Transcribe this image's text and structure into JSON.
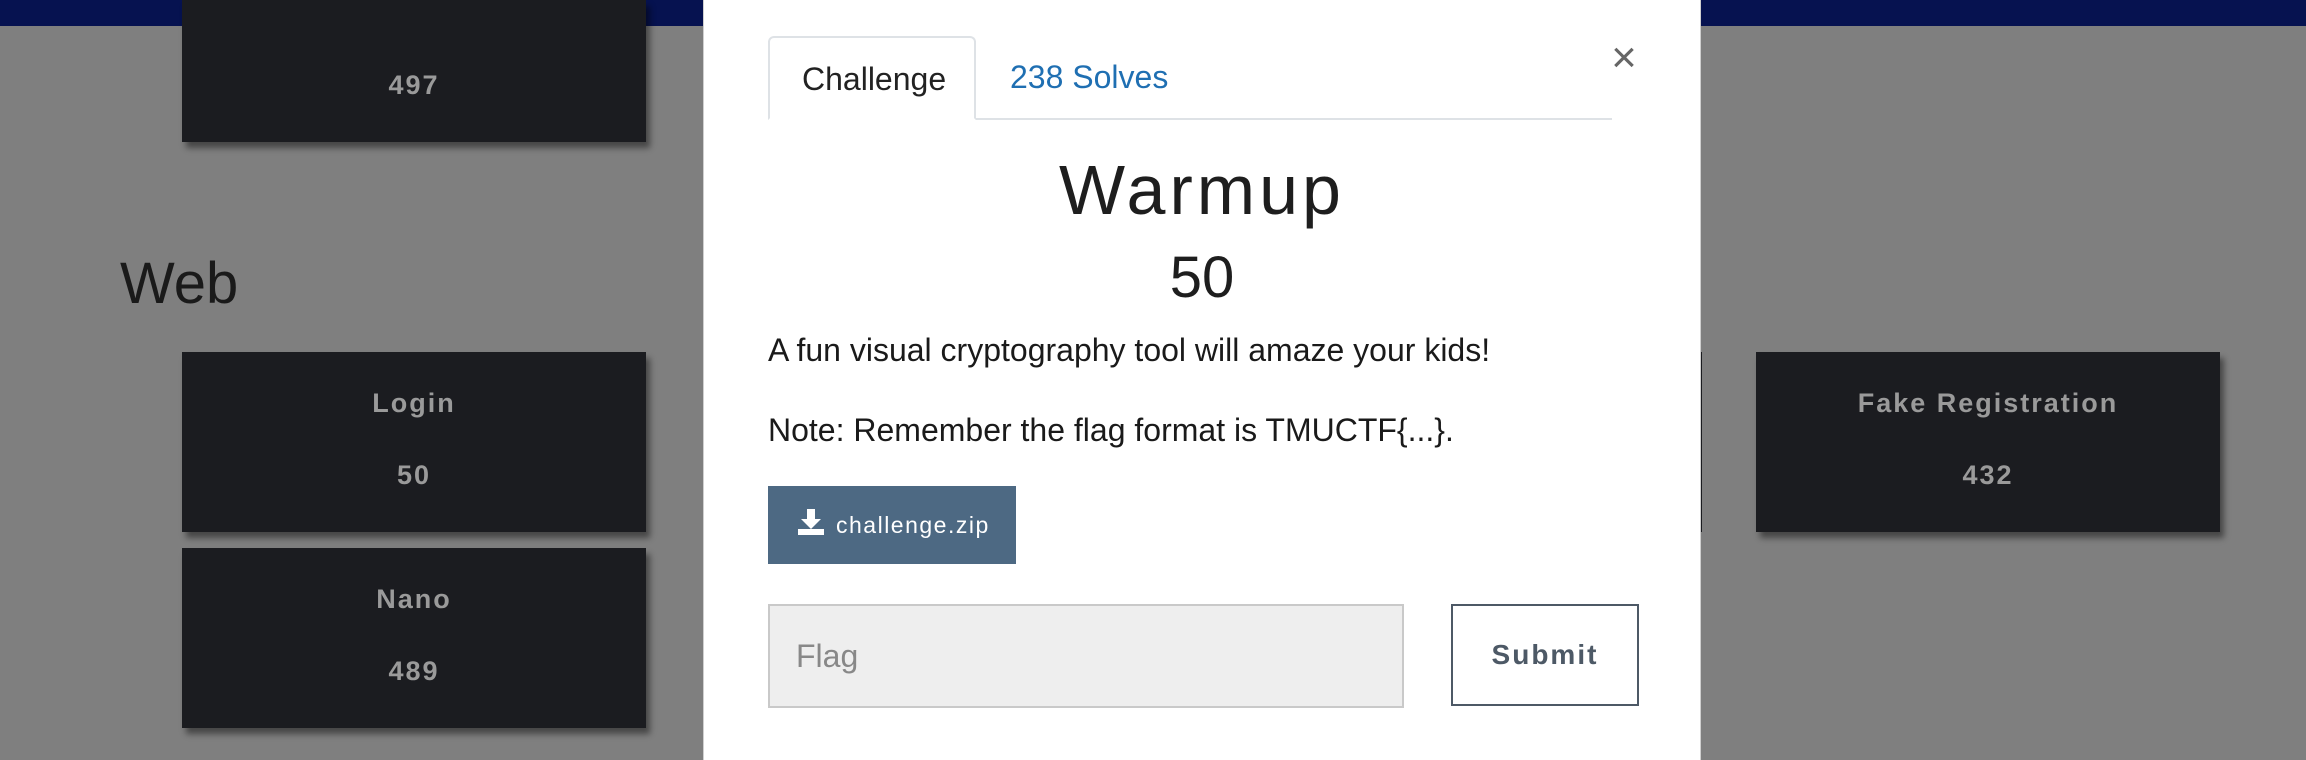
{
  "background": {
    "top_card": {
      "name": "",
      "points": "497"
    },
    "section_title": "Web",
    "cards": [
      {
        "name": "Login",
        "points": "50"
      },
      {
        "name": "Nano",
        "points": "489"
      },
      {
        "name": "Fake Registration",
        "points": "432"
      }
    ]
  },
  "modal": {
    "tabs": [
      {
        "label": "Challenge",
        "active": true
      },
      {
        "label": "238 Solves",
        "active": false
      }
    ],
    "close_symbol": "×",
    "challenge": {
      "name": "Warmup",
      "value": "50",
      "description": [
        "A fun visual cryptography tool will amaze your kids!",
        "Note: Remember the flag format is TMUCTF{...}."
      ],
      "file": {
        "label": "challenge.zip",
        "icon": "download-icon"
      }
    },
    "flag_input": {
      "placeholder": "Flag",
      "value": ""
    },
    "submit_label": "Submit"
  },
  "colors": {
    "navbar": "#061250",
    "backdrop": "#7f7f7f",
    "card": "#1b1c20",
    "link": "#1f6fb2",
    "download_button": "#4d6983"
  }
}
